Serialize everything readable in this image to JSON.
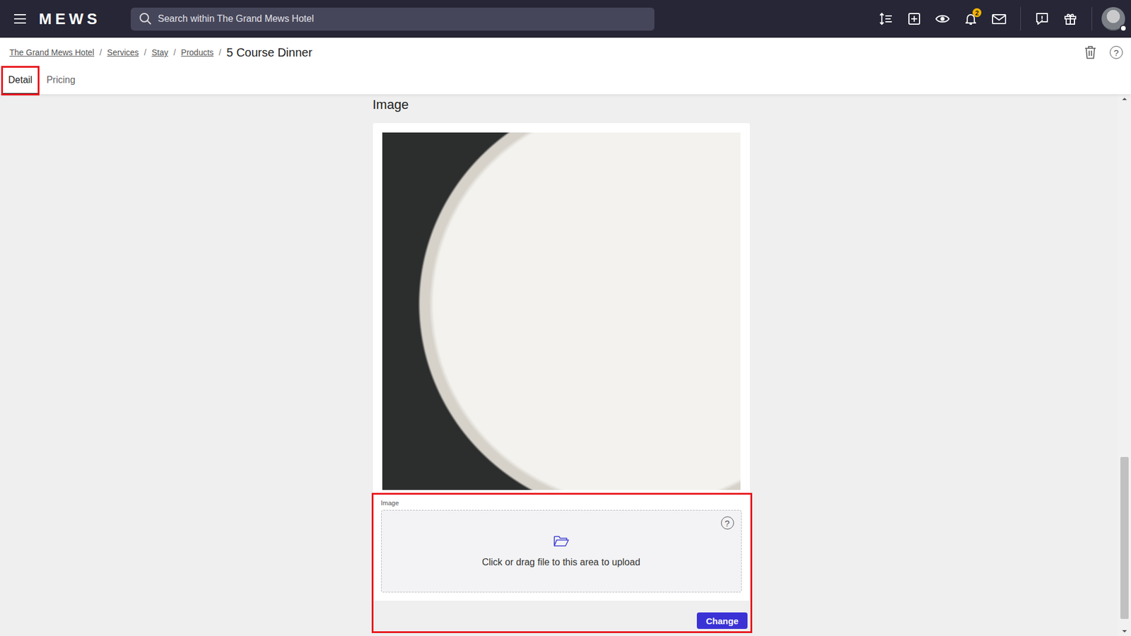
{
  "navbar": {
    "logo": "MEWS",
    "search_placeholder": "Search within The Grand Mews Hotel",
    "notification_count": "2"
  },
  "breadcrumb": {
    "items": [
      "The Grand Mews Hotel",
      "Services",
      "Stay",
      "Products"
    ],
    "separator": "/",
    "current": "5 Course Dinner"
  },
  "help_glyph": "?",
  "tabs": [
    {
      "label": "Detail",
      "selected": true,
      "highlighted": true
    },
    {
      "label": "Pricing",
      "selected": false,
      "highlighted": false
    }
  ],
  "section": {
    "title": "Image",
    "field_label": "Image",
    "dropzone_text": "Click or drag file to this area to upload",
    "button": "Change",
    "highlighted": true
  }
}
